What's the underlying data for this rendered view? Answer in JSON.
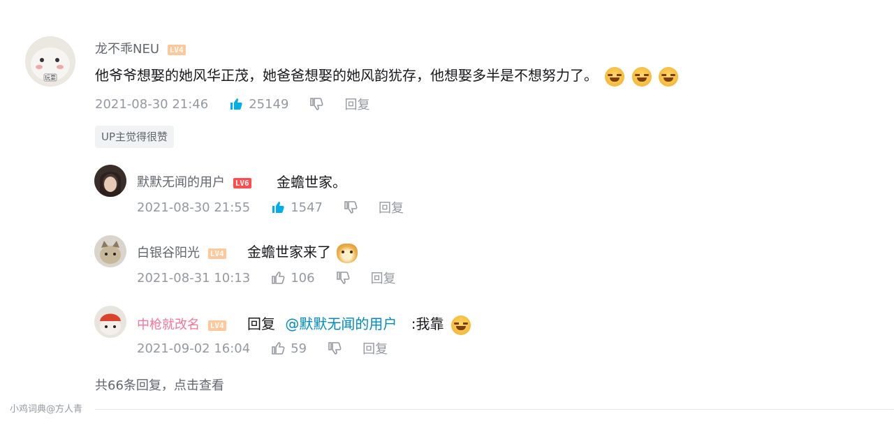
{
  "main_comment": {
    "username": "龙不乖NEU",
    "level": "LV4",
    "avatar_text": "玩耍",
    "text": "他爷爷想娶的她风华正茂，她爸爸想娶的她风韵犹存，他想娶多半是不想努力了。",
    "date": "2021-08-30 21:46",
    "likes": "25149",
    "reply_label": "回复",
    "up_badge": "UP主觉得很赞"
  },
  "replies": [
    {
      "username": "默默无闻的用户",
      "level": "LV6",
      "text": "金蟾世家。",
      "date": "2021-08-30 21:55",
      "likes": "1547",
      "reply_label": "回复"
    },
    {
      "username": "白银谷阳光",
      "level": "LV4",
      "text": "金蟾世家来了",
      "date": "2021-08-31 10:13",
      "likes": "106",
      "reply_label": "回复"
    },
    {
      "username": "中枪就改名",
      "level": "LV4",
      "reply_prefix": "回复",
      "mention": "@默默无闻的用户",
      "text": ":我靠",
      "date": "2021-09-02 16:04",
      "likes": "59",
      "reply_label": "回复"
    }
  ],
  "more_replies": "共66条回复，点击查看",
  "watermark": "小鸡词典@方人青",
  "colors": {
    "accent_blue": "#00aeec",
    "pink_name": "#fb7299",
    "level6": "#ff4d4d",
    "level4": "#ffc89a"
  }
}
